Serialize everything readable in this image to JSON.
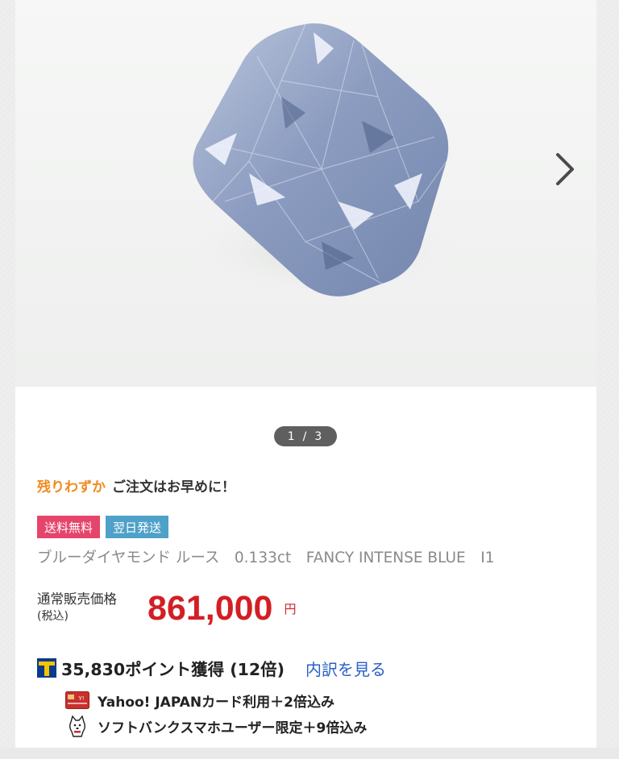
{
  "gallery": {
    "current_page": "1",
    "separator": "/",
    "total_pages": "3",
    "next_icon": "chevron-right-icon"
  },
  "stock": {
    "warning": "残りわずか",
    "message": "ご注文はお早めに！"
  },
  "badges": {
    "free_shipping": "送料無料",
    "next_day": "翌日発送"
  },
  "colors": {
    "stock_warning": "#f08a1d",
    "free_shipping_badge": "#e6456b",
    "next_day_badge": "#4ea1c8",
    "price": "#d21f25",
    "link": "#2a5fc6"
  },
  "product": {
    "title": "ブルーダイヤモンド ルース　0.133ct　FANCY INTENSE BLUE　I1"
  },
  "price": {
    "label": "通常販売価格",
    "tax_note": "(税込)",
    "value": "861,000",
    "unit": "円"
  },
  "points": {
    "icon": "tpoint-icon",
    "earned": "35,830ポイント獲得 (12倍)",
    "breakdown_link": "内訳を見る",
    "details": [
      {
        "icon": "credit-card-icon",
        "text": "Yahoo! JAPANカード利用＋2倍込み"
      },
      {
        "icon": "softbank-dog-icon",
        "text": "ソフトバンクスマホユーザー限定＋9倍込み"
      }
    ]
  }
}
